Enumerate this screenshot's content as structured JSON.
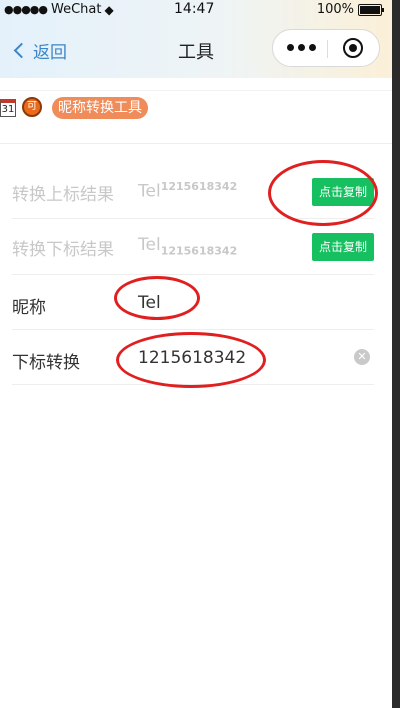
{
  "status": {
    "carrier": "WeChat",
    "signal": "●●●●●",
    "time": "14:47",
    "battery": "100%"
  },
  "nav": {
    "back_label": "返回",
    "title": "工具"
  },
  "toolbar": {
    "cal_day": "31",
    "badge": "可",
    "tag": "昵称转换工具"
  },
  "rows": [
    {
      "label": "转换上标结果",
      "base": "Tel",
      "script": "1215618342",
      "kind": "sup",
      "button": "点击复制"
    },
    {
      "label": "转换下标结果",
      "base": "Tel",
      "script": "1215618342",
      "kind": "sub",
      "button": "点击复制"
    },
    {
      "label": "昵称",
      "value": "Tel"
    },
    {
      "label": "下标转换",
      "value": "1215618342"
    }
  ],
  "colors": {
    "accent_green": "#16c060",
    "link_blue": "#3b86c8",
    "tag_orange": "#f08c5a",
    "annotation_red": "#e02020"
  }
}
